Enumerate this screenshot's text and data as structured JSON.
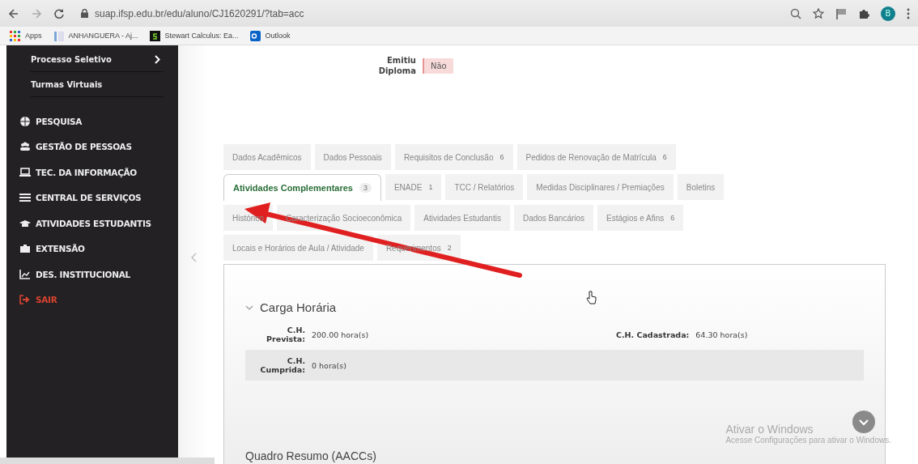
{
  "browser": {
    "url": "suap.ifsp.edu.br/edu/aluno/CJ1620291/?tab=acc",
    "profile_initial": "B",
    "bookmarks": [
      "Apps",
      "ANHANGUERA - Aj...",
      "Stewart Calculus: Ea...",
      "Outlook"
    ]
  },
  "sidebar": {
    "submenu": [
      {
        "label": "Processo Seletivo",
        "expandable": true
      },
      {
        "label": "Turmas Virtuais",
        "expandable": false
      }
    ],
    "items": [
      {
        "label": "PESQUISA",
        "kind": "section"
      },
      {
        "label": "GESTÃO DE PESSOAS",
        "kind": "section"
      },
      {
        "label": "TEC. DA INFORMAÇÃO",
        "kind": "section"
      },
      {
        "label": "CENTRAL DE SERVIÇOS",
        "kind": "section"
      },
      {
        "label": "ATIVIDADES ESTUDANTIS",
        "kind": "section"
      },
      {
        "label": "EXTENSÃO",
        "kind": "section"
      },
      {
        "label": "DES. INSTITUCIONAL",
        "kind": "section"
      },
      {
        "label": "SAIR",
        "kind": "logout"
      }
    ]
  },
  "diploma": {
    "label": "Emitiu Diploma",
    "value": "Não"
  },
  "tab_rows": [
    [
      {
        "label": "Dados Acadêmicos",
        "selected": false
      },
      {
        "label": "Dados Pessoais",
        "selected": false
      },
      {
        "label": "Requisitos de Conclusão",
        "count": "6",
        "selected": false
      },
      {
        "label": "Pedidos de Renovação de Matrícula",
        "count": "6",
        "selected": false
      }
    ],
    [
      {
        "label": "Atividades Complementares",
        "count": "3",
        "selected": true
      },
      {
        "label": "ENADE",
        "count": "1",
        "selected": false
      },
      {
        "label": "TCC / Relatórios",
        "selected": false
      },
      {
        "label": "Medidas Disciplinares / Premiações",
        "selected": false
      },
      {
        "label": "Boletins",
        "selected": false
      }
    ],
    [
      {
        "label": "Histórico",
        "selected": false
      },
      {
        "label": "Caracterização Socioeconômica",
        "selected": false
      },
      {
        "label": "Atividades Estudantis",
        "selected": false
      },
      {
        "label": "Dados Bancários",
        "selected": false
      },
      {
        "label": "Estágios e Afins",
        "count": "6",
        "selected": false
      }
    ],
    [
      {
        "label": "Locais e Horários de Aula / Atividade",
        "selected": false
      },
      {
        "label": "Requerimentos",
        "count": "2",
        "selected": false
      }
    ]
  ],
  "section": {
    "title": "Carga Horária",
    "expanded": true,
    "rows": [
      {
        "shaded": false,
        "fields": [
          {
            "label": "C.H. Prevista:",
            "value": "200.00 hora(s)"
          },
          {
            "label": "C.H. Cadastrada:",
            "value": "64.30 hora(s)"
          }
        ]
      },
      {
        "shaded": true,
        "fields": [
          {
            "label": "C.H. Cumprida:",
            "value": "0 hora(s)"
          }
        ]
      }
    ]
  },
  "next_section": {
    "title": "Quadro Resumo (AACCs)"
  },
  "os_notice": {
    "title": "Ativar o Windows",
    "text": "Acesse Configurações para ativar o Windows."
  }
}
